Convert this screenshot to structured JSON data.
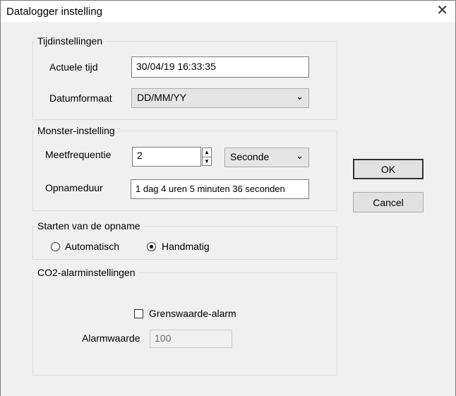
{
  "window": {
    "title": "Datalogger instelling",
    "close_glyph": "✕"
  },
  "time_settings": {
    "legend": "Tijdinstellingen",
    "actual_time_label": "Actuele tijd",
    "actual_time_value": "30/04/19 16:33:35",
    "date_format_label": "Datumformaat",
    "date_format_value": "DD/MM/YY"
  },
  "sample_settings": {
    "legend": "Monster-instelling",
    "frequency_label": "Meetfrequentie",
    "frequency_value": "2",
    "unit_value": "Seconde",
    "duration_label": "Opnameduur",
    "duration_value": "1 dag 4 uren 5 minuten 36 seconden"
  },
  "recording_start": {
    "legend": "Starten van de opname",
    "options": [
      {
        "label": "Automatisch",
        "selected": false
      },
      {
        "label": "Handmatig",
        "selected": true
      }
    ]
  },
  "co2_alarm": {
    "legend": "CO2-alarminstellingen",
    "threshold_alarm_label": "Grenswaarde-alarm",
    "threshold_alarm_checked": false,
    "alarm_value_label": "Alarmwaarde",
    "alarm_value": "100"
  },
  "buttons": {
    "ok": "OK",
    "cancel": "Cancel"
  },
  "icons": {
    "close": "close-icon",
    "chevron": "chevron-down-icon",
    "spin_up": "up-arrow-icon",
    "spin_down": "down-arrow-icon"
  }
}
